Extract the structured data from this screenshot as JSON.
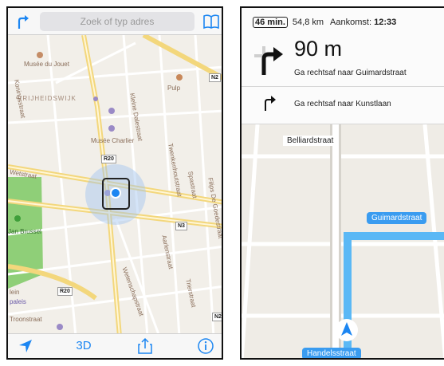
{
  "left": {
    "search": {
      "placeholder": "Zoek of typ adres"
    },
    "map_labels": {
      "musee_jouet": "Musée du Jouet",
      "vrijheidswijk": "VRIJHEIDSWIJK",
      "pulp": "Pulp",
      "musee_charlier": "Musée Charlier",
      "koningsstraat": "Koningsstraat",
      "kleine_daelstraat": "Kleine Dalestraat",
      "twenkenhoutstraat": "Twenkenhoutstraat",
      "spastraat": "Spastraat",
      "filips_de_goedestraat": "Filips De Goedestraat",
      "wetstraat": "Wetstraat",
      "jan_brussel": "Jan Brussel",
      "aarlenstraat": "Aarlenstraat",
      "trierstraat": "Trierstraat",
      "wetenschapstraat": "Wetenschapstraat",
      "paleis": "paleis",
      "troonstraat": "Troonstraat",
      "lein": "lein"
    },
    "road_signs": {
      "r20_top": "R20",
      "n2": "N2",
      "n3": "N3",
      "r20_bottom": "R20",
      "n2_bottom": "N2"
    },
    "bottom": {
      "three_d": "3D"
    }
  },
  "right": {
    "eta": {
      "minutes": "46 min.",
      "distance": "54,8 km",
      "arrival_label": "Aankomst:",
      "arrival_time": "12:33"
    },
    "current": {
      "distance": "90 m",
      "instruction": "Ga rechtsaf naar Guimardstraat"
    },
    "next": {
      "instruction": "Ga rechtsaf naar Kunstlaan"
    },
    "map": {
      "street_top": "Belliardstraat",
      "street_right": "Guimardstraat",
      "street_bottom": "Handelsstraat"
    }
  },
  "colors": {
    "accent": "#1c86f2",
    "route": "#3a9cf0",
    "park": "#8fcf78"
  }
}
